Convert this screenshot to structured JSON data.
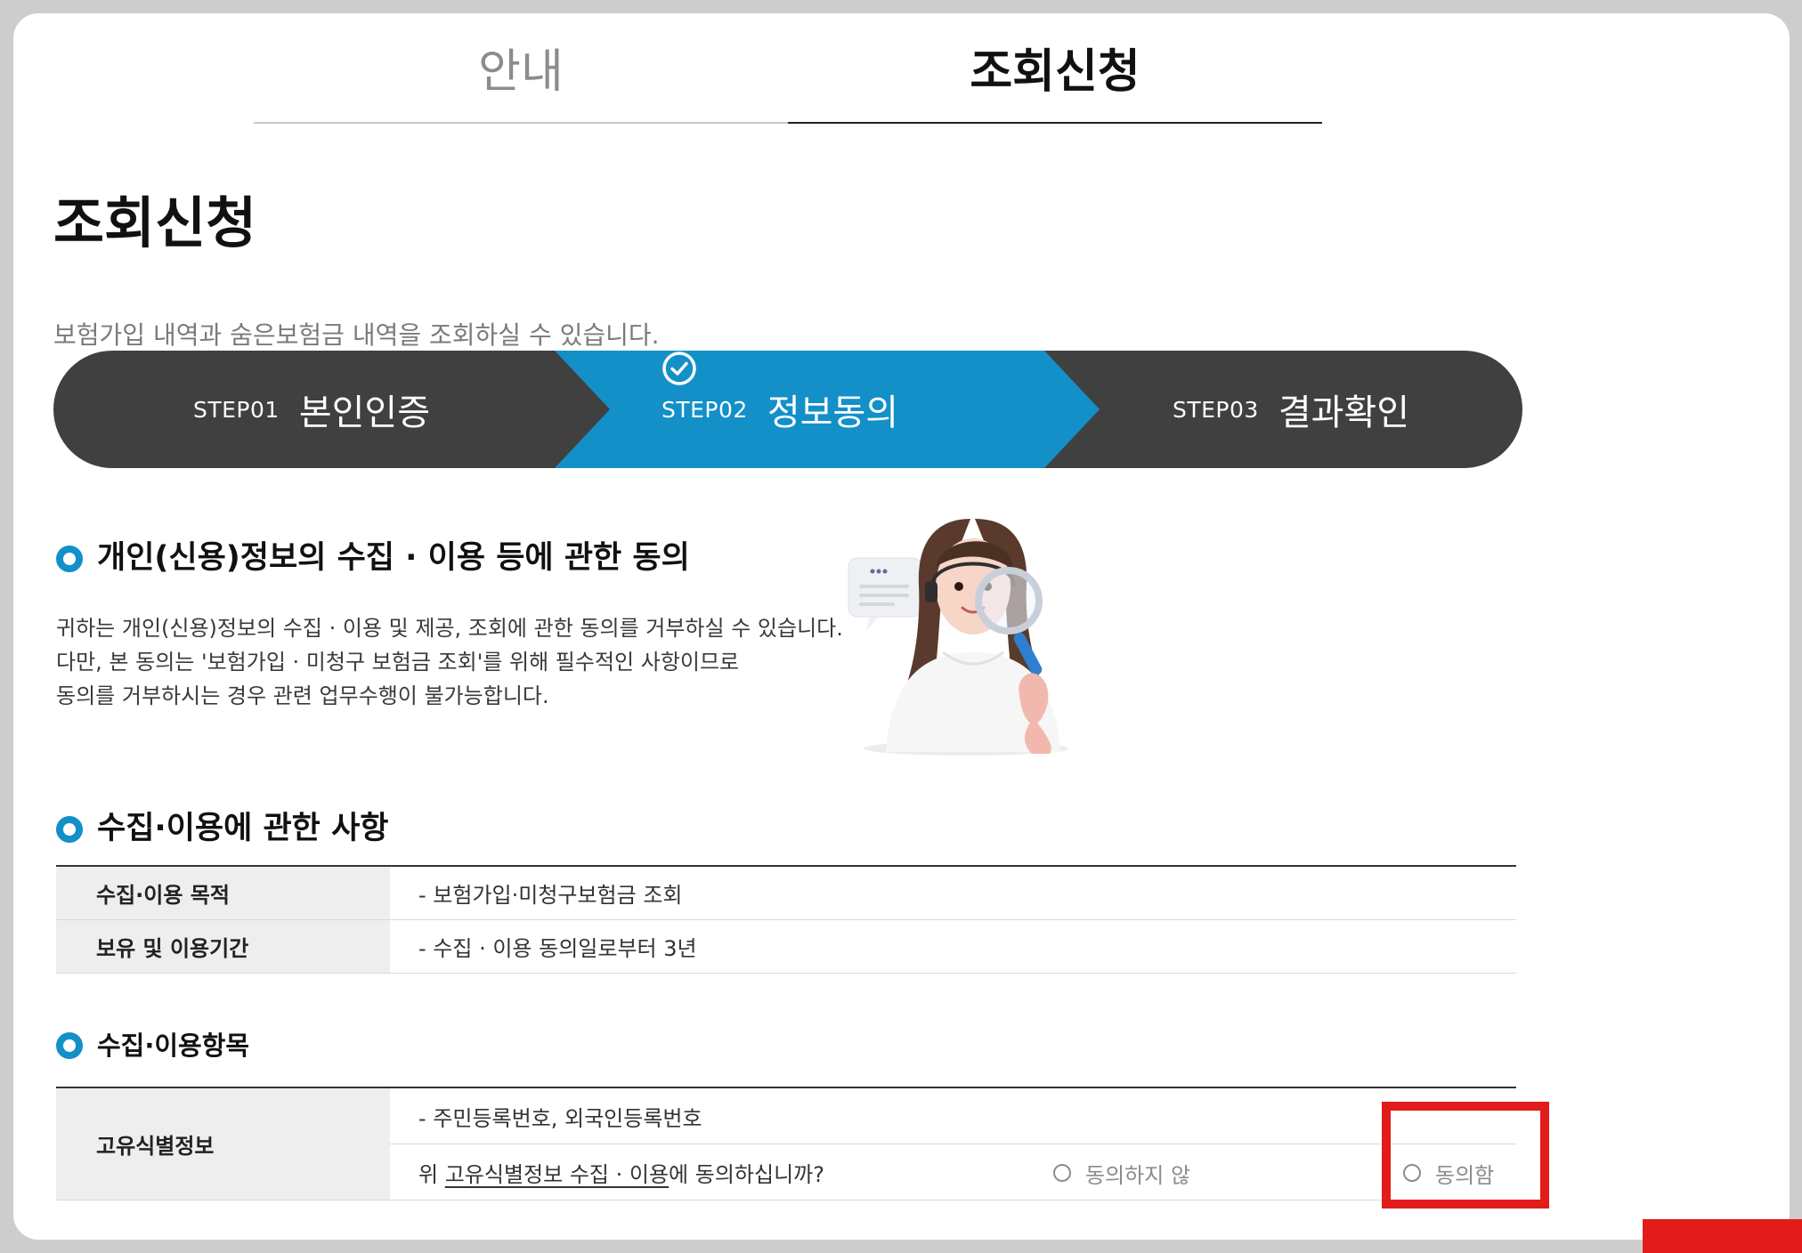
{
  "tabs": [
    {
      "label": "안내",
      "active": false
    },
    {
      "label": "조회신청",
      "active": true
    }
  ],
  "page": {
    "title": "조회신청",
    "description": "보험가입 내역과 숨은보험금 내역을 조회하실 수 있습니다."
  },
  "steps": [
    {
      "number": "STEP01",
      "name": "본인인증",
      "current": false
    },
    {
      "number": "STEP02",
      "name": "정보동의",
      "current": true
    },
    {
      "number": "STEP03",
      "name": "결과확인",
      "current": false
    }
  ],
  "consent": {
    "heading": "개인(신용)정보의 수집 · 이용 등에 관한 동의",
    "lines": [
      "귀하는 개인(신용)정보의 수집 · 이용 및 제공, 조회에 관한 동의를 거부하실 수 있습니다.",
      "다만, 본 동의는 '보험가입 · 미청구 보험금 조회'를 위해 필수적인 사항이므로",
      "동의를 거부하시는 경우 관련 업무수행이 불가능합니다."
    ]
  },
  "collection": {
    "heading": "수집·이용에 관한 사항",
    "rows": [
      {
        "label": "수집·이용 목적",
        "value": "- 보험가입·미청구보험금 조회"
      },
      {
        "label": "보유 및 이용기간",
        "value": "- 수집 · 이용 동의일로부터 3년"
      }
    ]
  },
  "items": {
    "heading": "수집·이용항목",
    "row_label": "고유식별정보",
    "value": "- 주민등록번호, 외국인등록번호",
    "question_prefix": "위 ",
    "question_link": "고유식별정보 수집 · 이용",
    "question_suffix": "에 동의하십니까?",
    "options": [
      {
        "label": "동의하지 않",
        "selected": false
      },
      {
        "label": "동의함",
        "selected": false
      }
    ]
  },
  "colors": {
    "accent": "#1390c8",
    "step_dark": "#404040",
    "highlight": "#e21b1b"
  }
}
